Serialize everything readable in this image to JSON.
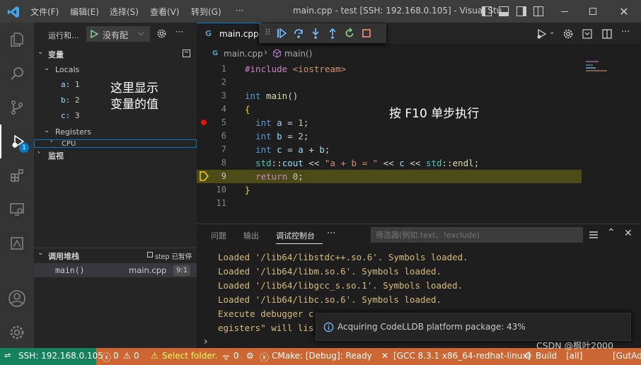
{
  "titlebar": {
    "menu": [
      "文件(F)",
      "编辑(E)",
      "选择(S)",
      "查看(V)",
      "转到(G)",
      "···"
    ],
    "title": "main.cpp - test [SSH: 192.168.0.105] - Visual Stu..."
  },
  "activity": {
    "debug_badge": "1"
  },
  "sidebar": {
    "run_label": "运行和...",
    "config_label": "没有配",
    "variables_header": "变量",
    "locals_label": "Locals",
    "locals": [
      {
        "name": "a",
        "value": "1"
      },
      {
        "name": "b",
        "value": "2"
      },
      {
        "name": "c",
        "value": "3"
      }
    ],
    "registers_label": "Registers",
    "cpu_label": "CPU",
    "watch_header": "监视",
    "callstack_header": "调用堆栈",
    "callstack_status": "step 已暂停",
    "frame": {
      "fn": "main()",
      "file": "main.cpp",
      "pos": "9:1"
    },
    "annotation_vars": "这里显示\n变量的值"
  },
  "editor": {
    "tab_label": "main.cpp",
    "breadcrumb_file": "main.cpp",
    "breadcrumb_symbol": "main()",
    "annotation_step": "按 F10 单步执行",
    "line_numbers": [
      "1",
      "2",
      "3",
      "4",
      "5",
      "6",
      "7",
      "8",
      "9",
      "10",
      "11"
    ]
  },
  "panel": {
    "tabs": [
      "问题",
      "输出",
      "调试控制台",
      "···"
    ],
    "filter_placeholder": "筛选器(例如 text、!exclude)",
    "logs": [
      "Loaded '/lib64/libstdc++.so.6'. Symbols loaded.",
      "Loaded '/lib64/libm.so.6'. Symbols loaded.",
      "Loaded '/lib64/libgcc_s.so.1'. Symbols loaded.",
      "Loaded '/lib64/libc.so.6'. Symbols loaded.",
      "Execute debugger c",
      "egisters\" will lis"
    ],
    "notification": "Acquiring CodeLLDB platform package: 43%"
  },
  "statusbar": {
    "ssh": "SSH: 192.168.0.105",
    "errors": "0",
    "warnings": "0",
    "select_folder": "Select folder.",
    "ports": "0",
    "cmake": "CMake: [Debug]: Ready",
    "kit": "[GCC 8.3.1 x86_64-redhat-linux]",
    "build": "Build",
    "all": "[all]",
    "guitadd": "[GutAdd",
    "watermark": "CSDN @枫叶2000"
  },
  "colors": {
    "accent": "#007acc",
    "statusbar": "#cc6633",
    "ssh_badge": "#16825d",
    "current_line": "#4b4b18"
  }
}
